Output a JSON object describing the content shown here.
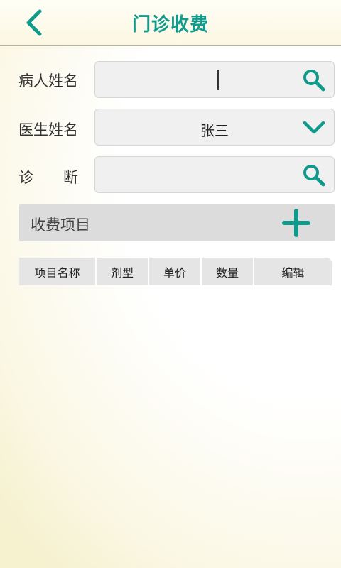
{
  "header": {
    "title": "门诊收费",
    "back_icon": "chevron-left-icon"
  },
  "form": {
    "patient_name": {
      "label": "病人姓名",
      "value": "",
      "icon": "search-icon"
    },
    "doctor_name": {
      "label": "医生姓名",
      "value": "张三",
      "icon": "chevron-down-icon"
    },
    "diagnosis": {
      "label": "诊　　断",
      "value": "",
      "icon": "search-icon"
    }
  },
  "section": {
    "label": "收费项目",
    "icon": "plus-icon"
  },
  "table": {
    "columns": [
      "项目名称",
      "剂型",
      "单价",
      "数量",
      "编辑"
    ],
    "rows": []
  },
  "colors": {
    "accent": "#109a8c",
    "field_bg": "#f0f0f0",
    "section_bg": "#dcdcdc"
  }
}
